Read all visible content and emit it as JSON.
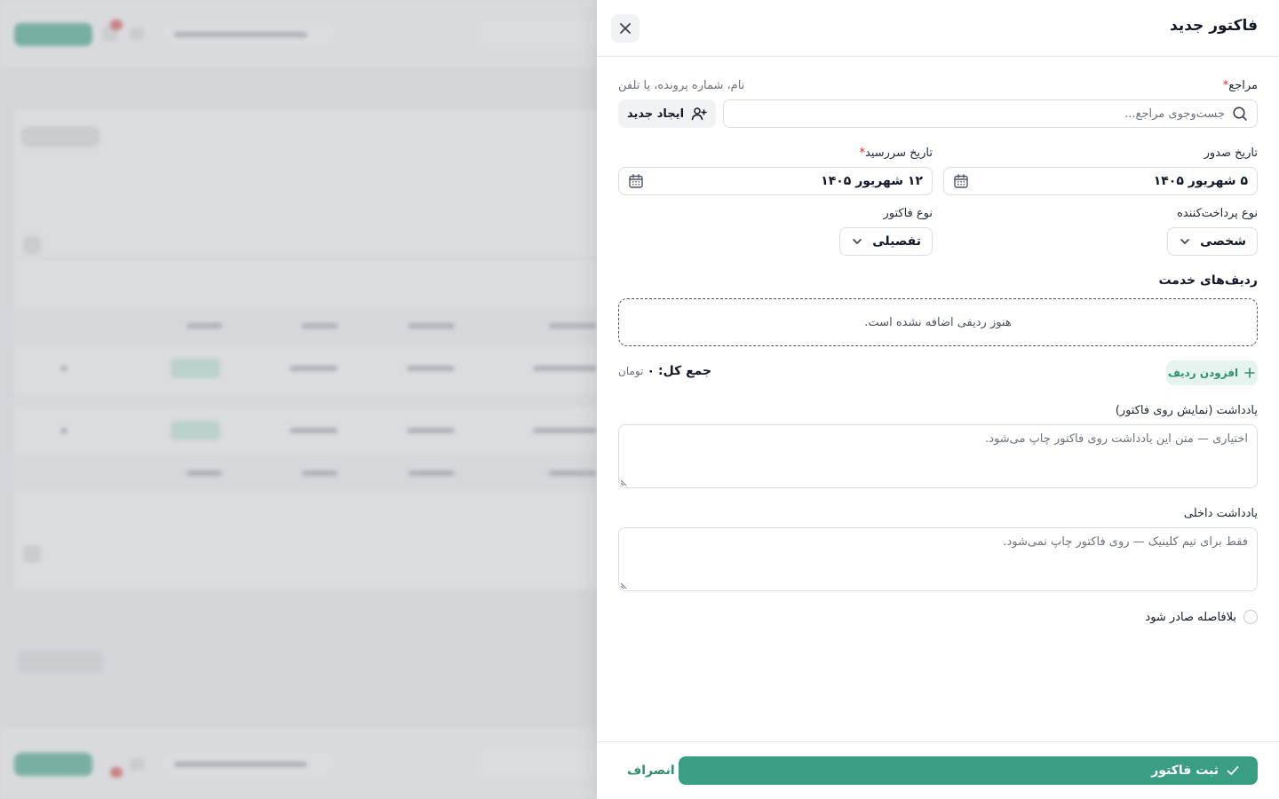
{
  "drawer": {
    "title": "فاکتور جدید"
  },
  "patient": {
    "label": "مراجع",
    "required_mark": "*",
    "hint": "نام، شماره پرونده، یا تلفن",
    "search_placeholder": "جست‌وجوی مراجع...",
    "create_new_label": "ایجاد جدید"
  },
  "issue_date": {
    "label": "تاریخ صدور",
    "value": "۵ شهریور ۱۴۰۵"
  },
  "due_date": {
    "label": "تاریخ سررسید",
    "required_mark": "*",
    "value": "۱۲ شهریور ۱۴۰۵"
  },
  "payer_type": {
    "label": "نوع پرداخت‌کننده",
    "value": "شخصی"
  },
  "invoice_type": {
    "label": "نوع فاکتور",
    "value": "تفصیلی"
  },
  "service_rows": {
    "title": "ردیف‌های خدمت",
    "empty_text": "هنوز ردیفی اضافه نشده است.",
    "add_row_label": "افزودن ردیف",
    "total_label": "جمع کل:",
    "total_value": "۰",
    "total_unit": "تومان"
  },
  "invoice_note": {
    "label": "یادداشت (نمایش روی فاکتور)",
    "placeholder": "اختیاری — متن این یادداشت روی فاکتور چاپ می‌شود."
  },
  "internal_note": {
    "label": "یادداشت داخلی",
    "placeholder": "فقط برای تیم کلینیک — روی فاکتور چاپ نمی‌شود."
  },
  "issue_now": {
    "label": "بلافاصله صادر شود",
    "checked": false
  },
  "footer": {
    "submit_label": "ثبت فاکتور",
    "cancel_label": "انصراف"
  },
  "colors": {
    "primary": "#3a9e84",
    "primary_soft": "#e6f4ef",
    "required": "#dc2626"
  }
}
